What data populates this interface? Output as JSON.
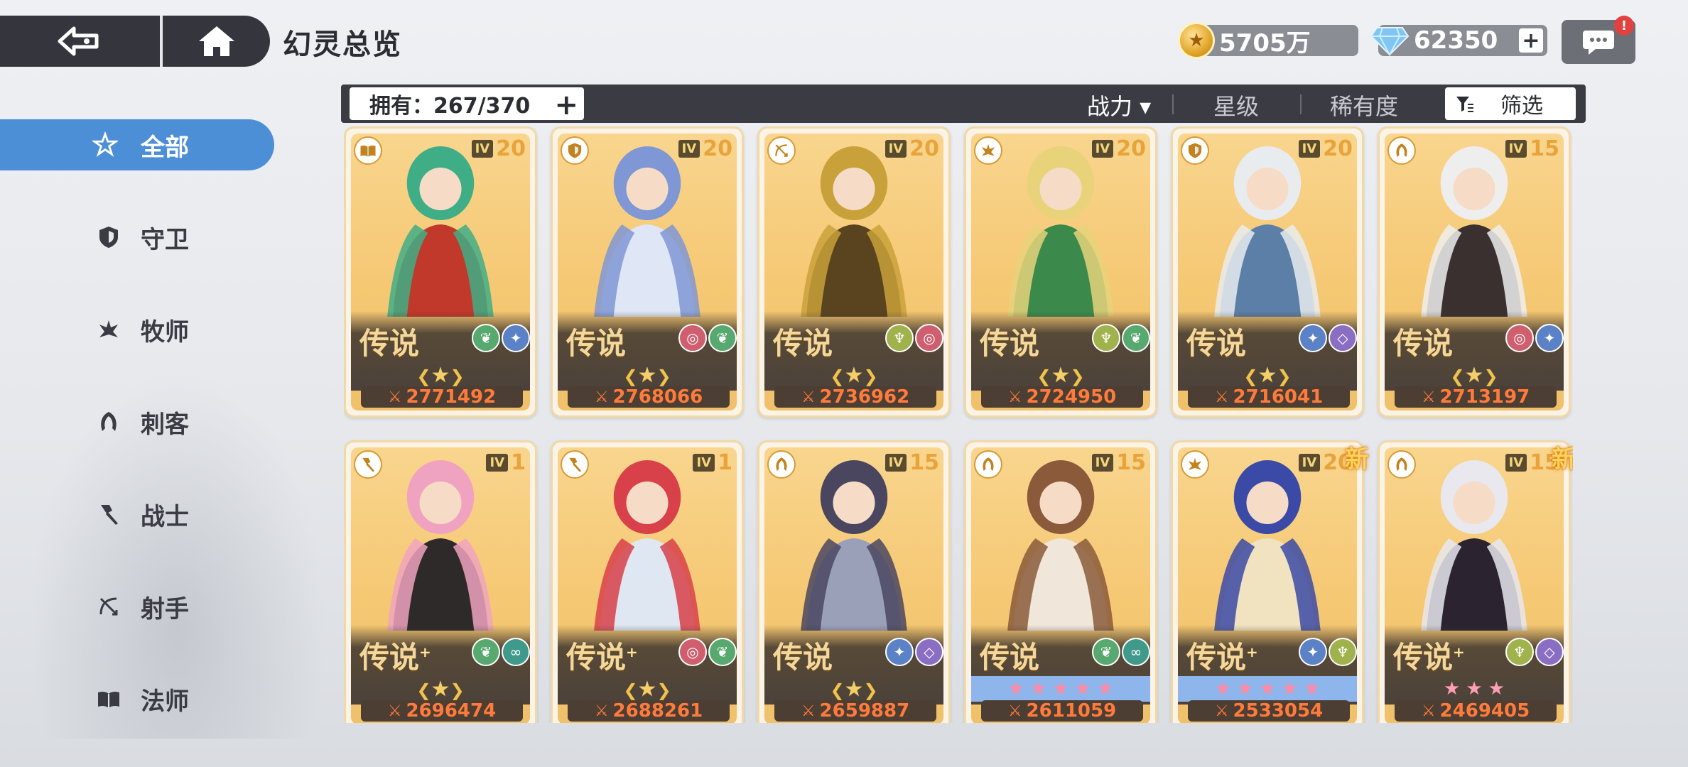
{
  "header": {
    "title": "幻灵总览",
    "gold": "5705万",
    "gems": "62350",
    "gem_plus": "+",
    "chat_alert": "!"
  },
  "filter_bar": {
    "owned": "拥有：267/370",
    "owned_plus": "+",
    "sort_power": "战力 ▾",
    "sort_star": "星级",
    "sort_rarity": "稀有度",
    "filter": "筛选"
  },
  "sidebar": {
    "items": [
      {
        "label": "全部",
        "icon": "all-icon",
        "active": true
      },
      {
        "label": "守卫",
        "icon": "shield-icon",
        "active": false
      },
      {
        "label": "牧师",
        "icon": "priest-icon",
        "active": false
      },
      {
        "label": "刺客",
        "icon": "assassin-icon",
        "active": false
      },
      {
        "label": "战士",
        "icon": "warrior-icon",
        "active": false
      },
      {
        "label": "射手",
        "icon": "archer-icon",
        "active": false
      },
      {
        "label": "法师",
        "icon": "mage-icon",
        "active": false
      }
    ]
  },
  "cards": [
    {
      "roman": "IV",
      "level": "20",
      "rarity": "传说",
      "plus": false,
      "power": "2771492",
      "class_icon": "mage-icon",
      "elements": [
        "water",
        "star"
      ],
      "stars": 0,
      "new": false,
      "palette": [
        "#3fae86",
        "#c0392b"
      ]
    },
    {
      "roman": "IV",
      "level": "20",
      "rarity": "传说",
      "plus": false,
      "power": "2768066",
      "class_icon": "shield-icon",
      "elements": [
        "spiral",
        "water"
      ],
      "stars": 0,
      "new": false,
      "palette": [
        "#7f97d4",
        "#dfe6f5"
      ]
    },
    {
      "roman": "IV",
      "level": "20",
      "rarity": "传说",
      "plus": false,
      "power": "2736962",
      "class_icon": "archer-icon",
      "elements": [
        "leaf",
        "spiral"
      ],
      "stars": 0,
      "new": false,
      "palette": [
        "#c9a13a",
        "#5a4420"
      ]
    },
    {
      "roman": "IV",
      "level": "20",
      "rarity": "传说",
      "plus": false,
      "power": "2724950",
      "class_icon": "priest-icon",
      "elements": [
        "leaf",
        "water"
      ],
      "stars": 0,
      "new": false,
      "palette": [
        "#e8d27a",
        "#3b8a4c"
      ]
    },
    {
      "roman": "IV",
      "level": "20",
      "rarity": "传说",
      "plus": false,
      "power": "2716041",
      "class_icon": "shield-icon",
      "elements": [
        "star",
        "void"
      ],
      "stars": 0,
      "new": false,
      "palette": [
        "#e9ecef",
        "#5b7fa6"
      ]
    },
    {
      "roman": "IV",
      "level": "15",
      "rarity": "传说",
      "plus": false,
      "power": "2713197",
      "class_icon": "assassin-icon",
      "elements": [
        "spiral",
        "star"
      ],
      "stars": 0,
      "new": false,
      "palette": [
        "#eeeeee",
        "#3a3030"
      ]
    },
    {
      "roman": "IV",
      "level": "1",
      "rarity": "传说",
      "plus": true,
      "power": "2696474",
      "class_icon": "warrior-icon",
      "elements": [
        "water",
        "wave"
      ],
      "stars": 0,
      "new": false,
      "palette": [
        "#f0a3c0",
        "#2f2a2a"
      ]
    },
    {
      "roman": "IV",
      "level": "1",
      "rarity": "传说",
      "plus": true,
      "power": "2688261",
      "class_icon": "warrior-icon",
      "elements": [
        "spiral",
        "water"
      ],
      "stars": 0,
      "new": false,
      "palette": [
        "#d8404a",
        "#dfe7f2"
      ]
    },
    {
      "roman": "IV",
      "level": "15",
      "rarity": "传说",
      "plus": false,
      "power": "2659887",
      "class_icon": "assassin-icon",
      "elements": [
        "star",
        "void"
      ],
      "stars": 0,
      "new": false,
      "palette": [
        "#4a4660",
        "#9aa0b8"
      ]
    },
    {
      "roman": "IV",
      "level": "15",
      "rarity": "传说",
      "plus": false,
      "power": "2611059",
      "class_icon": "assassin-icon",
      "elements": [
        "water",
        "wave"
      ],
      "stars": 5,
      "new": false,
      "palette": [
        "#8a5a3a",
        "#f1e6da"
      ]
    },
    {
      "roman": "IV",
      "level": "20",
      "rarity": "传说",
      "plus": true,
      "power": "2533054",
      "class_icon": "priest-icon",
      "elements": [
        "star",
        "leaf"
      ],
      "stars": 5,
      "new": true,
      "new_label": "新",
      "palette": [
        "#3b4aa6",
        "#f1e3c0"
      ]
    },
    {
      "roman": "IV",
      "level": "15",
      "rarity": "传说",
      "plus": true,
      "power": "2469405",
      "class_icon": "assassin-icon",
      "elements": [
        "leaf",
        "void"
      ],
      "stars": 3,
      "new": true,
      "new_label": "新",
      "palette": [
        "#e8e8ee",
        "#2b2430"
      ]
    }
  ]
}
